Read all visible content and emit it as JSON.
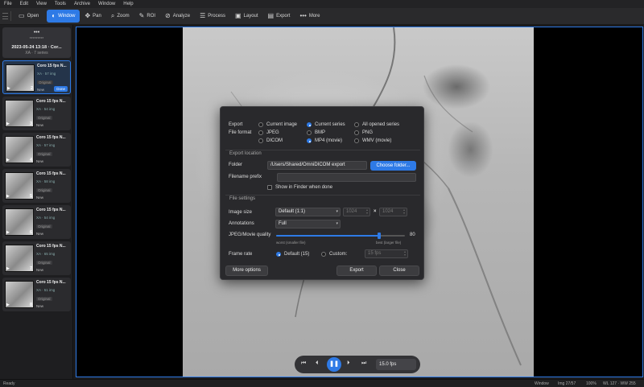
{
  "menu": [
    "File",
    "Edit",
    "View",
    "Tools",
    "Archive",
    "Window",
    "Help"
  ],
  "toolbar": {
    "open": "Open",
    "window": "Window",
    "pan": "Pan",
    "zoom": "Zoom",
    "roi": "ROI",
    "analyze": "Analyze",
    "process": "Process",
    "layout": "Layout",
    "export": "Export",
    "more": "More"
  },
  "study": {
    "dots": "•••",
    "stars": "*********",
    "date": "2023-05-24 13:18 · Cor...",
    "count": "XA · 7 series"
  },
  "series": [
    {
      "title": "Coro 15 fps N...",
      "count": "XA · 57 img",
      "badge": "Original",
      "status": "New",
      "num": "2",
      "done": "Done",
      "selected": true
    },
    {
      "title": "Coro 15 fps N...",
      "count": "XA · 54 img",
      "badge": "Original",
      "status": "New",
      "num": "3"
    },
    {
      "title": "Coro 15 fps N...",
      "count": "XA · 57 img",
      "badge": "Original",
      "status": "New",
      "num": "4"
    },
    {
      "title": "Coro 15 fps N...",
      "count": "XA · 58 img",
      "badge": "Original",
      "status": "New",
      "num": "5"
    },
    {
      "title": "Coro 15 fps N...",
      "count": "XA · 54 img",
      "badge": "Original",
      "status": "New",
      "num": "6"
    },
    {
      "title": "Coro 15 fps N...",
      "count": "XA · 65 img",
      "badge": "Original",
      "status": "New",
      "num": "7"
    },
    {
      "title": "Coro 15 fps N...",
      "count": "XA · 51 img",
      "badge": "Original",
      "status": "New",
      "num": "8"
    }
  ],
  "dialog": {
    "export_label": "Export",
    "export_options": [
      "Current image",
      "Current series",
      "All opened series"
    ],
    "export_selected": "Current series",
    "format_label": "File format",
    "format_options": [
      "JPEG",
      "BMP",
      "PNG",
      "DICOM",
      "MP4 (movie)",
      "WMV (movie)"
    ],
    "format_selected": "MP4 (movie)",
    "location_header": "Export location",
    "folder_label": "Folder",
    "folder_value": "/Users/Shared/OmniDICOM export",
    "choose_folder": "Choose folder...",
    "prefix_label": "Filename prefix",
    "prefix_value": "",
    "show_finder": "Show in Finder when done",
    "show_finder_checked": false,
    "settings_header": "File settings",
    "size_label": "Image size",
    "size_value": "Default (1:1)",
    "width_value": "1024",
    "height_value": "1024",
    "times": "×",
    "annotations_label": "Annotations",
    "annotations_value": "Full",
    "quality_label": "JPEG/Movie quality",
    "quality_value": "80",
    "quality_fraction": 0.8,
    "quality_min": "worst (smaller file)",
    "quality_max": "best (larger file)",
    "framerate_label": "Frame rate",
    "framerate_default": "Default (15)",
    "framerate_custom": "Custom:",
    "framerate_custom_value": "15 fps",
    "more_options": "More options",
    "export_button": "Export",
    "close_button": "Close"
  },
  "playback": {
    "fps": "15.0 fps"
  },
  "status": {
    "left": "Ready",
    "tool": "Window",
    "img": "Img 27/57",
    "zoom": "100%",
    "wl": "WL 127 · WW 255"
  },
  "colors": {
    "accent": "#2e7ae6",
    "background": "#1b1b1d",
    "dialog": "#29292c"
  }
}
